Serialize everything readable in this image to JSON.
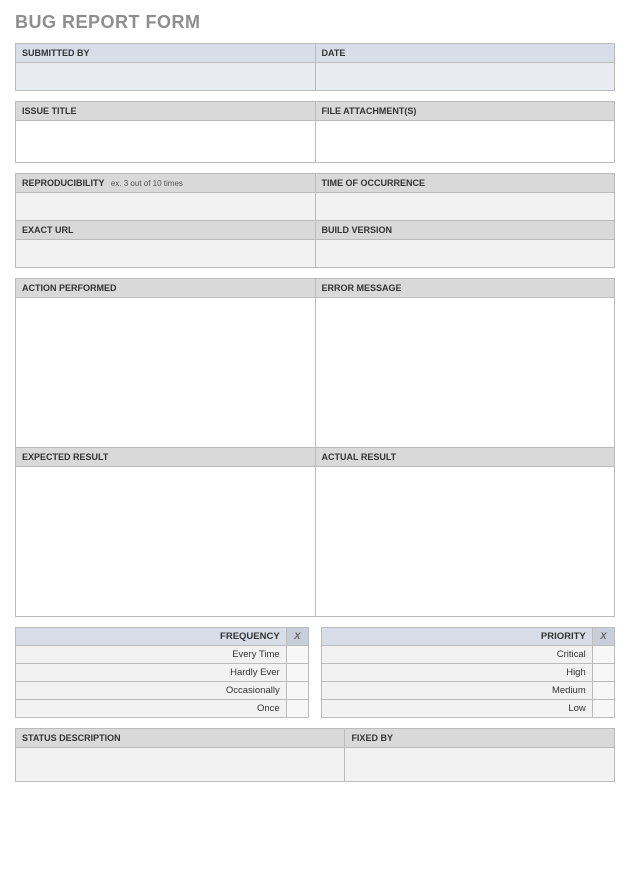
{
  "title": "BUG REPORT FORM",
  "section1": {
    "submitted_by": "SUBMITTED BY",
    "date": "DATE"
  },
  "section2": {
    "issue_title": "ISSUE TITLE",
    "file_attachments": "FILE ATTACHMENT(S)"
  },
  "section3": {
    "reproducibility": "REPRODUCIBILITY",
    "reproducibility_hint": "ex. 3 out of 10 times",
    "time_of_occurrence": "TIME OF OCCURRENCE",
    "exact_url": "EXACT URL",
    "build_version": "BUILD VERSION"
  },
  "section4": {
    "action_performed": "ACTION PERFORMED",
    "error_message": "ERROR MESSAGE",
    "expected_result": "EXPECTED RESULT",
    "actual_result": "ACTUAL RESULT"
  },
  "freq_pri": {
    "frequency_header": "FREQUENCY",
    "priority_header": "PRIORITY",
    "x": "X",
    "frequency": [
      "Every Time",
      "Hardly Ever",
      "Occasionally",
      "Once"
    ],
    "priority": [
      "Critical",
      "High",
      "Medium",
      "Low"
    ]
  },
  "section6": {
    "status_description": "STATUS DESCRIPTION",
    "fixed_by": "FIXED BY"
  }
}
